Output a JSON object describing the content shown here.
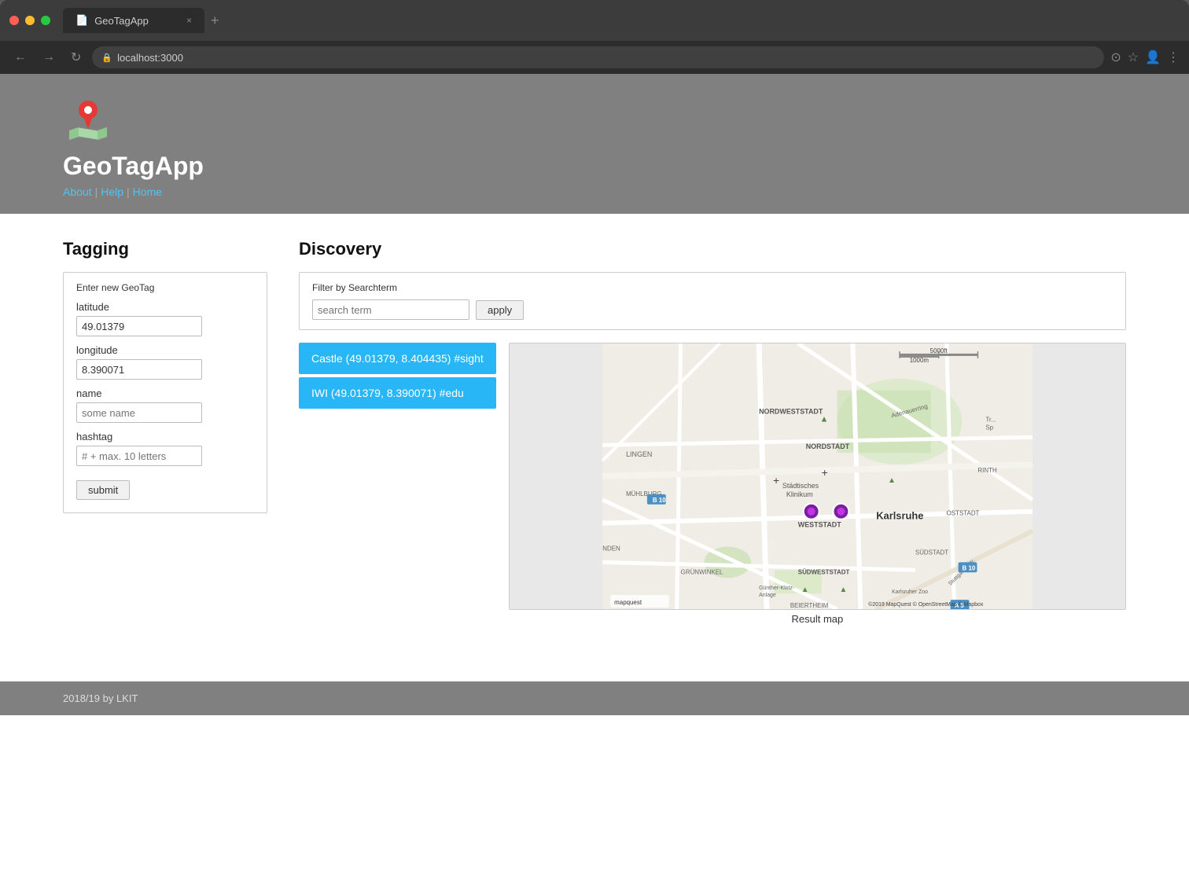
{
  "browser": {
    "tab_title": "GeoTagApp",
    "address": "localhost:3000",
    "nav_back": "←",
    "nav_forward": "→",
    "nav_reload": "↻",
    "new_tab_icon": "+",
    "close_tab_icon": "×"
  },
  "header": {
    "app_title": "GeoTagApp",
    "nav_about": "About",
    "nav_help": "Help",
    "nav_home": "Home",
    "separator": "|"
  },
  "tagging": {
    "section_title": "Tagging",
    "fieldset_legend": "Enter new GeoTag",
    "latitude_label": "latitude",
    "latitude_value": "49.01379",
    "longitude_label": "longitude",
    "longitude_value": "8.390071",
    "name_label": "name",
    "name_placeholder": "some name",
    "hashtag_label": "hashtag",
    "hashtag_placeholder": "# + max. 10 letters",
    "submit_label": "submit"
  },
  "discovery": {
    "section_title": "Discovery",
    "filter_legend": "Filter by Searchterm",
    "search_placeholder": "search term",
    "apply_label": "apply",
    "results": [
      {
        "text": "Castle (49.01379, 8.404435) #sight",
        "lat": 49.01379,
        "lng": 8.404435
      },
      {
        "text": "IWI (49.01379, 8.390071) #edu",
        "lat": 49.01379,
        "lng": 8.390071
      }
    ],
    "map_caption": "Result map"
  },
  "footer": {
    "text": "2018/19 by LKIT"
  },
  "colors": {
    "header_bg": "#808080",
    "accent": "#29b6f6",
    "link": "#4fc3f7",
    "footer_bg": "#808080"
  }
}
